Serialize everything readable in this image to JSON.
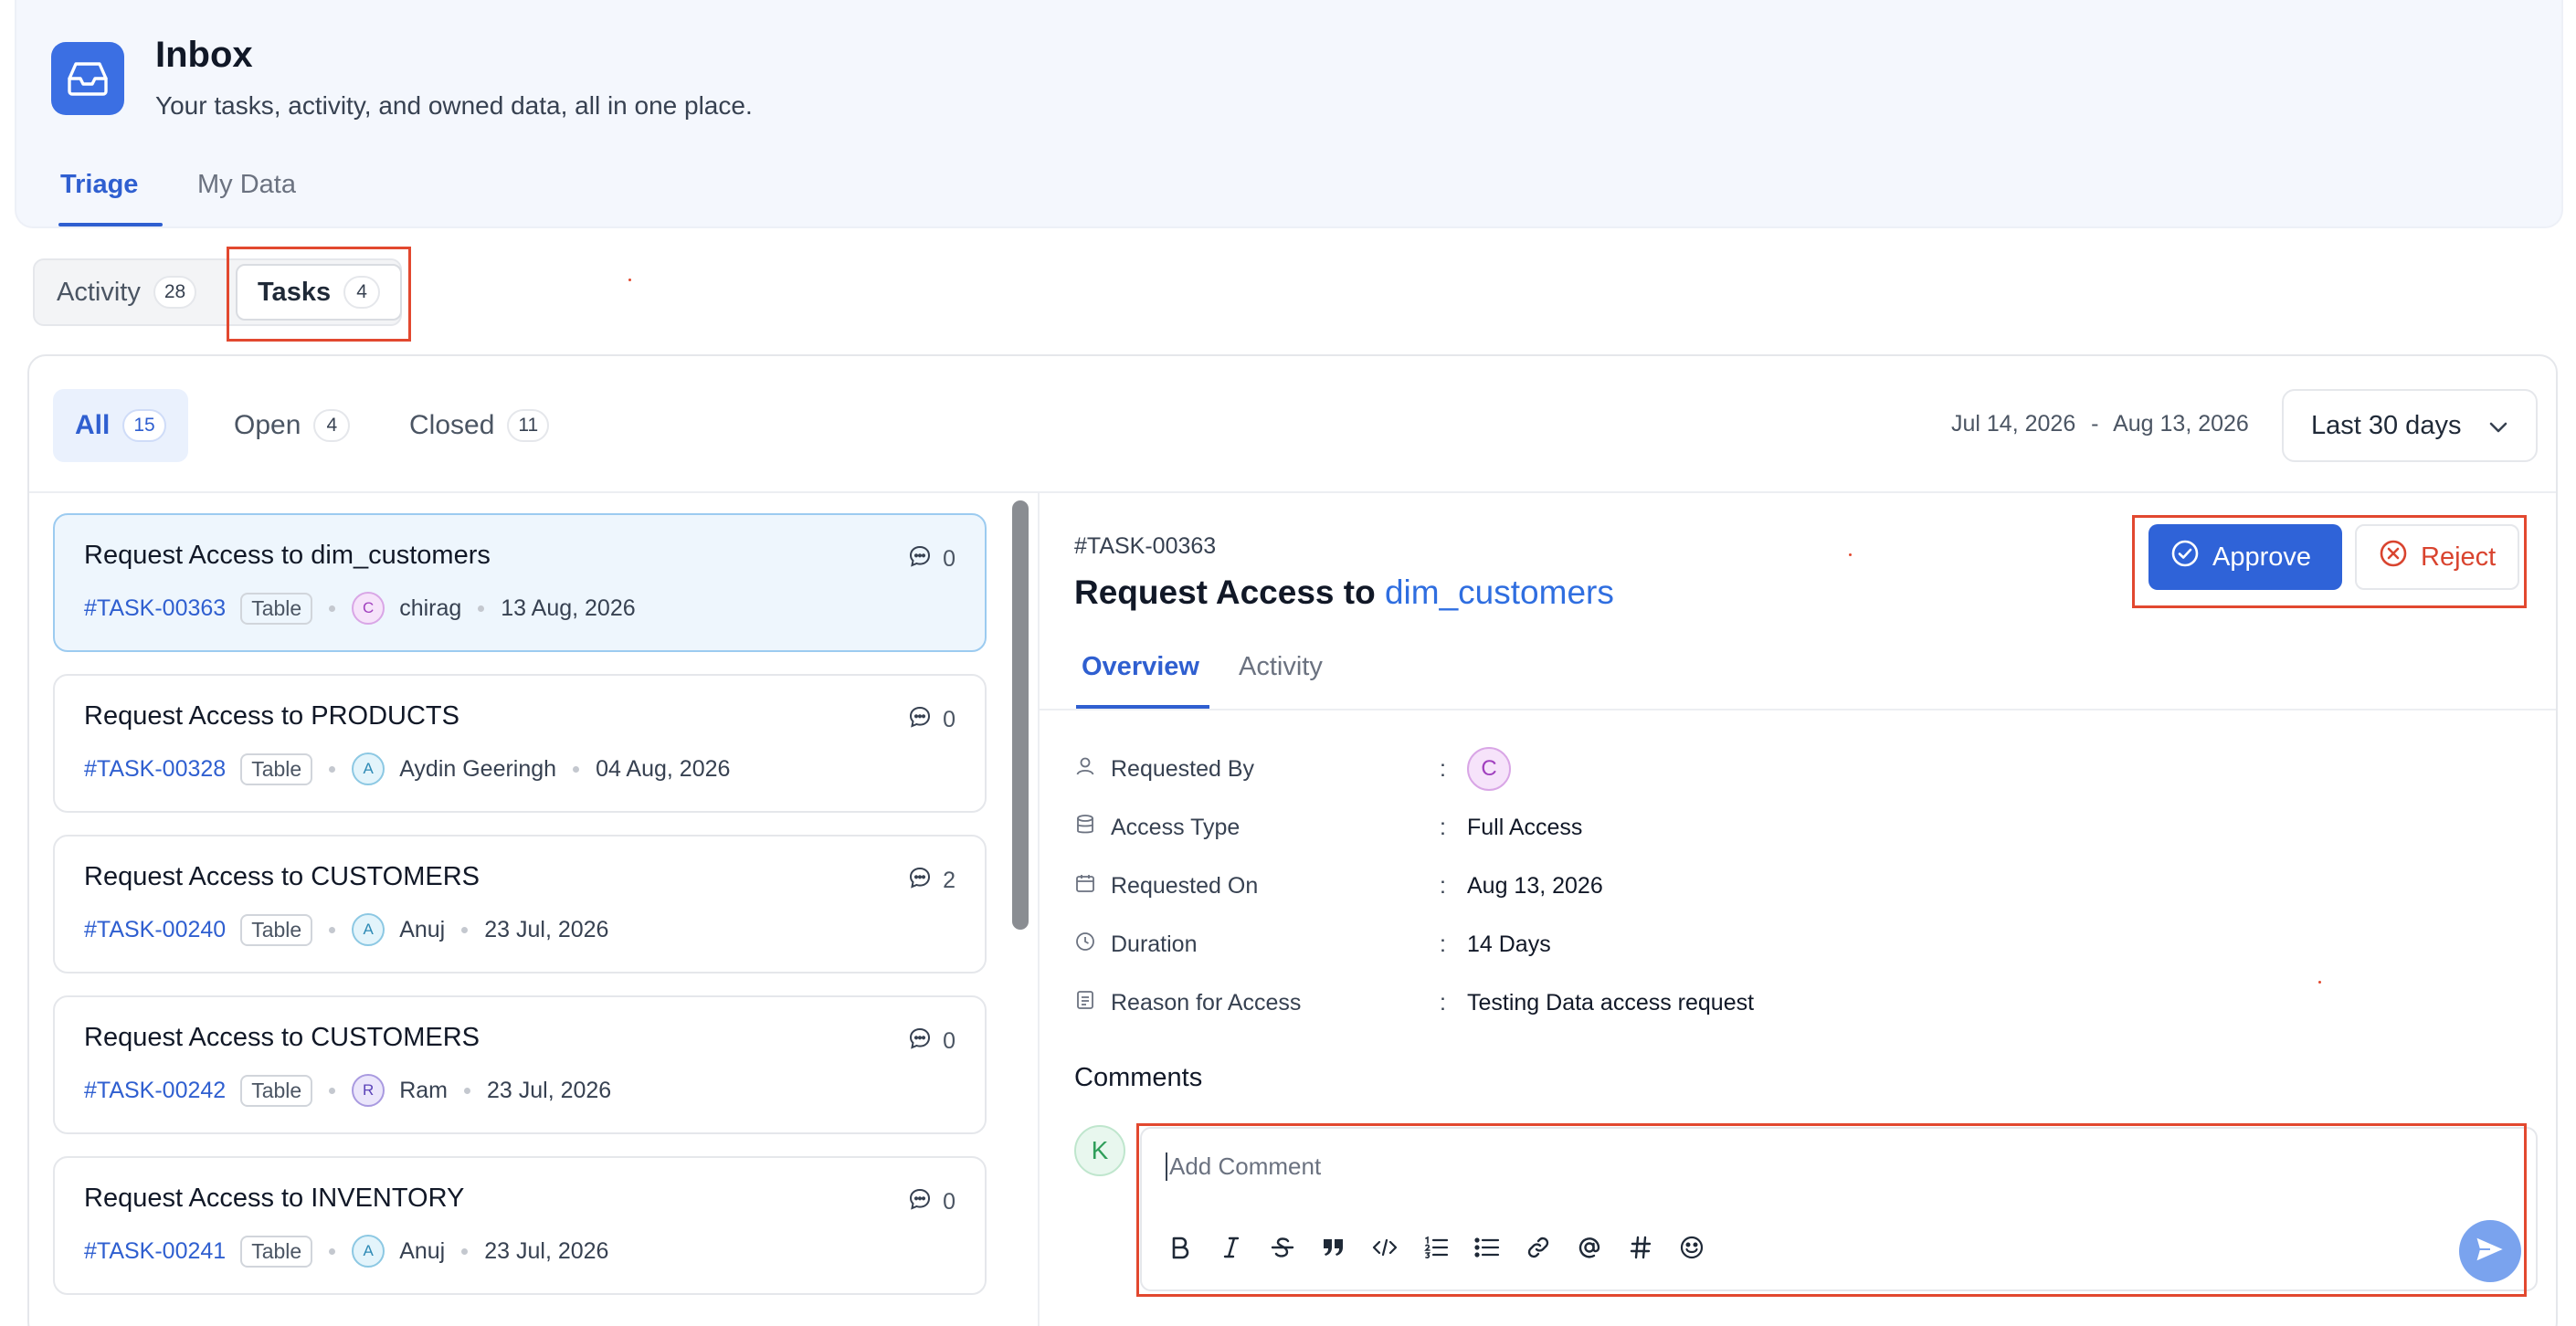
{
  "header": {
    "title": "Inbox",
    "subtitle": "Your tasks, activity, and owned data, all in one place.",
    "tabs": [
      {
        "label": "Triage"
      },
      {
        "label": "My Data"
      }
    ]
  },
  "segment": {
    "items": [
      {
        "label": "Activity",
        "count": "28"
      },
      {
        "label": "Tasks",
        "count": "4"
      }
    ]
  },
  "filters": {
    "items": [
      {
        "label": "All",
        "count": "15"
      },
      {
        "label": "Open",
        "count": "4"
      },
      {
        "label": "Closed",
        "count": "11"
      }
    ],
    "date_start": "Jul 14, 2026",
    "date_sep": "-",
    "date_end": "Aug 13, 2026",
    "period": "Last 30 days"
  },
  "tasks": [
    {
      "title": "Request Access to dim_customers",
      "id": "#TASK-00363",
      "type": "Table",
      "avatar": "C",
      "user": "chirag",
      "date": "13 Aug, 2026",
      "comments": "0"
    },
    {
      "title": "Request Access to PRODUCTS",
      "id": "#TASK-00328",
      "type": "Table",
      "avatar": "A",
      "user": "Aydin Geeringh",
      "date": "04 Aug, 2026",
      "comments": "0"
    },
    {
      "title": "Request Access to CUSTOMERS",
      "id": "#TASK-00240",
      "type": "Table",
      "avatar": "A",
      "user": "Anuj",
      "date": "23 Jul, 2026",
      "comments": "2"
    },
    {
      "title": "Request Access to CUSTOMERS",
      "id": "#TASK-00242",
      "type": "Table",
      "avatar": "R",
      "user": "Ram",
      "date": "23 Jul, 2026",
      "comments": "0"
    },
    {
      "title": "Request Access to INVENTORY",
      "id": "#TASK-00241",
      "type": "Table",
      "avatar": "A",
      "user": "Anuj",
      "date": "23 Jul, 2026",
      "comments": "0"
    }
  ],
  "detail": {
    "id": "#TASK-00363",
    "title_prefix": "Request Access to",
    "title_link": "dim_customers",
    "approve_label": "Approve",
    "reject_label": "Reject",
    "tabs": [
      {
        "label": "Overview"
      },
      {
        "label": "Activity"
      }
    ],
    "fields": [
      {
        "label": "Requested By",
        "value": "",
        "avatar": "C"
      },
      {
        "label": "Access Type",
        "value": "Full Access"
      },
      {
        "label": "Requested On",
        "value": "Aug 13, 2026"
      },
      {
        "label": "Duration",
        "value": "14 Days"
      },
      {
        "label": "Reason for Access",
        "value": "Testing Data access request"
      }
    ],
    "colon": ":",
    "comments_heading": "Comments",
    "commenter_avatar": "K",
    "comment_placeholder": "Add Comment"
  },
  "colors": {
    "accent": "#2f5fd0",
    "approve": "#2f63d8",
    "reject": "#d9442f",
    "highlight": "#e2482f"
  },
  "icons": [
    "inbox-icon",
    "comment-icon",
    "user-icon",
    "database-icon",
    "calendar-icon",
    "clock-icon",
    "document-icon",
    "check-circle-icon",
    "x-circle-icon",
    "chevron-down-icon",
    "send-icon"
  ]
}
